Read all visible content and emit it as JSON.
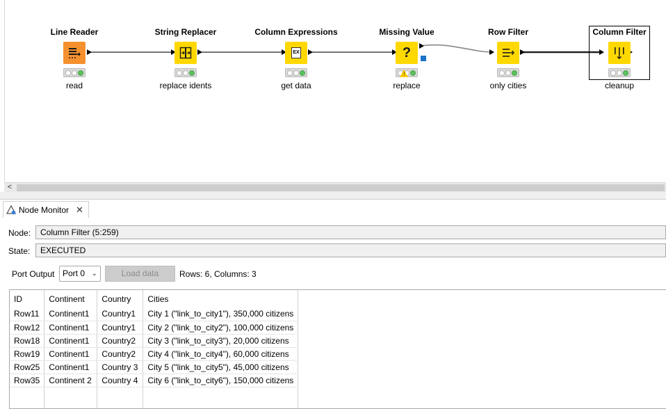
{
  "workflow": {
    "nodes": [
      {
        "title": "Line Reader",
        "label": "read",
        "icon": "line-reader-icon",
        "color": "#f5902e"
      },
      {
        "title": "String Replacer",
        "label": "replace idents",
        "icon": "string-replacer-icon",
        "color": "#ffd800"
      },
      {
        "title": "Column Expressions",
        "label": "get data",
        "icon": "column-expressions-icon",
        "color": "#ffd800"
      },
      {
        "title": "Missing Value",
        "label": "replace",
        "icon": "missing-value-icon",
        "color": "#ffd800"
      },
      {
        "title": "Row Filter",
        "label": "only cities",
        "icon": "row-filter-icon",
        "color": "#ffd800"
      },
      {
        "title": "Column Filter",
        "label": "cleanup",
        "icon": "column-filter-icon",
        "color": "#ffd800"
      }
    ],
    "expressions_glyph": "EX",
    "missing_glyph": "?",
    "warning_glyph": "!",
    "status_color": "#5dc15d"
  },
  "scrollbar": {
    "left_arrow": "<"
  },
  "monitor": {
    "tab_title": "Node Monitor",
    "tab_close": "✕",
    "node_label": "Node:",
    "node_value": "Column Filter  (5:259)",
    "state_label": "State:",
    "state_value": "EXECUTED",
    "port_output_label": "Port Output",
    "port_selected": "Port 0",
    "load_button": "Load data",
    "rows_info": "Rows: 6, Columns: 3"
  },
  "table": {
    "columns": [
      "ID",
      "Continent",
      "Country",
      "Cities"
    ],
    "rows": [
      [
        "Row11",
        "Continent1",
        "Country1",
        "City 1 (\"link_to_city1\"), 350,000 citizens"
      ],
      [
        "Row12",
        "Continent1",
        "Country1",
        "City 2 (\"link_to_city2\"), 100,000 citizens"
      ],
      [
        "Row18",
        "Continent1",
        "Country2",
        "City 3 (\"link_to_city3\"), 20,000 citizens"
      ],
      [
        "Row19",
        "Continent1",
        "Country2",
        "City 4 (\"link_to_city4\"), 60,000 citizens"
      ],
      [
        "Row25",
        "Continent1",
        "Country 3",
        "City 5 (\"link_to_city5\"), 45,000 citizens"
      ],
      [
        "Row35",
        "Continent 2",
        "Country 4",
        "City 6 (\"link_to_city6\"), 150,000 citizens"
      ]
    ]
  }
}
